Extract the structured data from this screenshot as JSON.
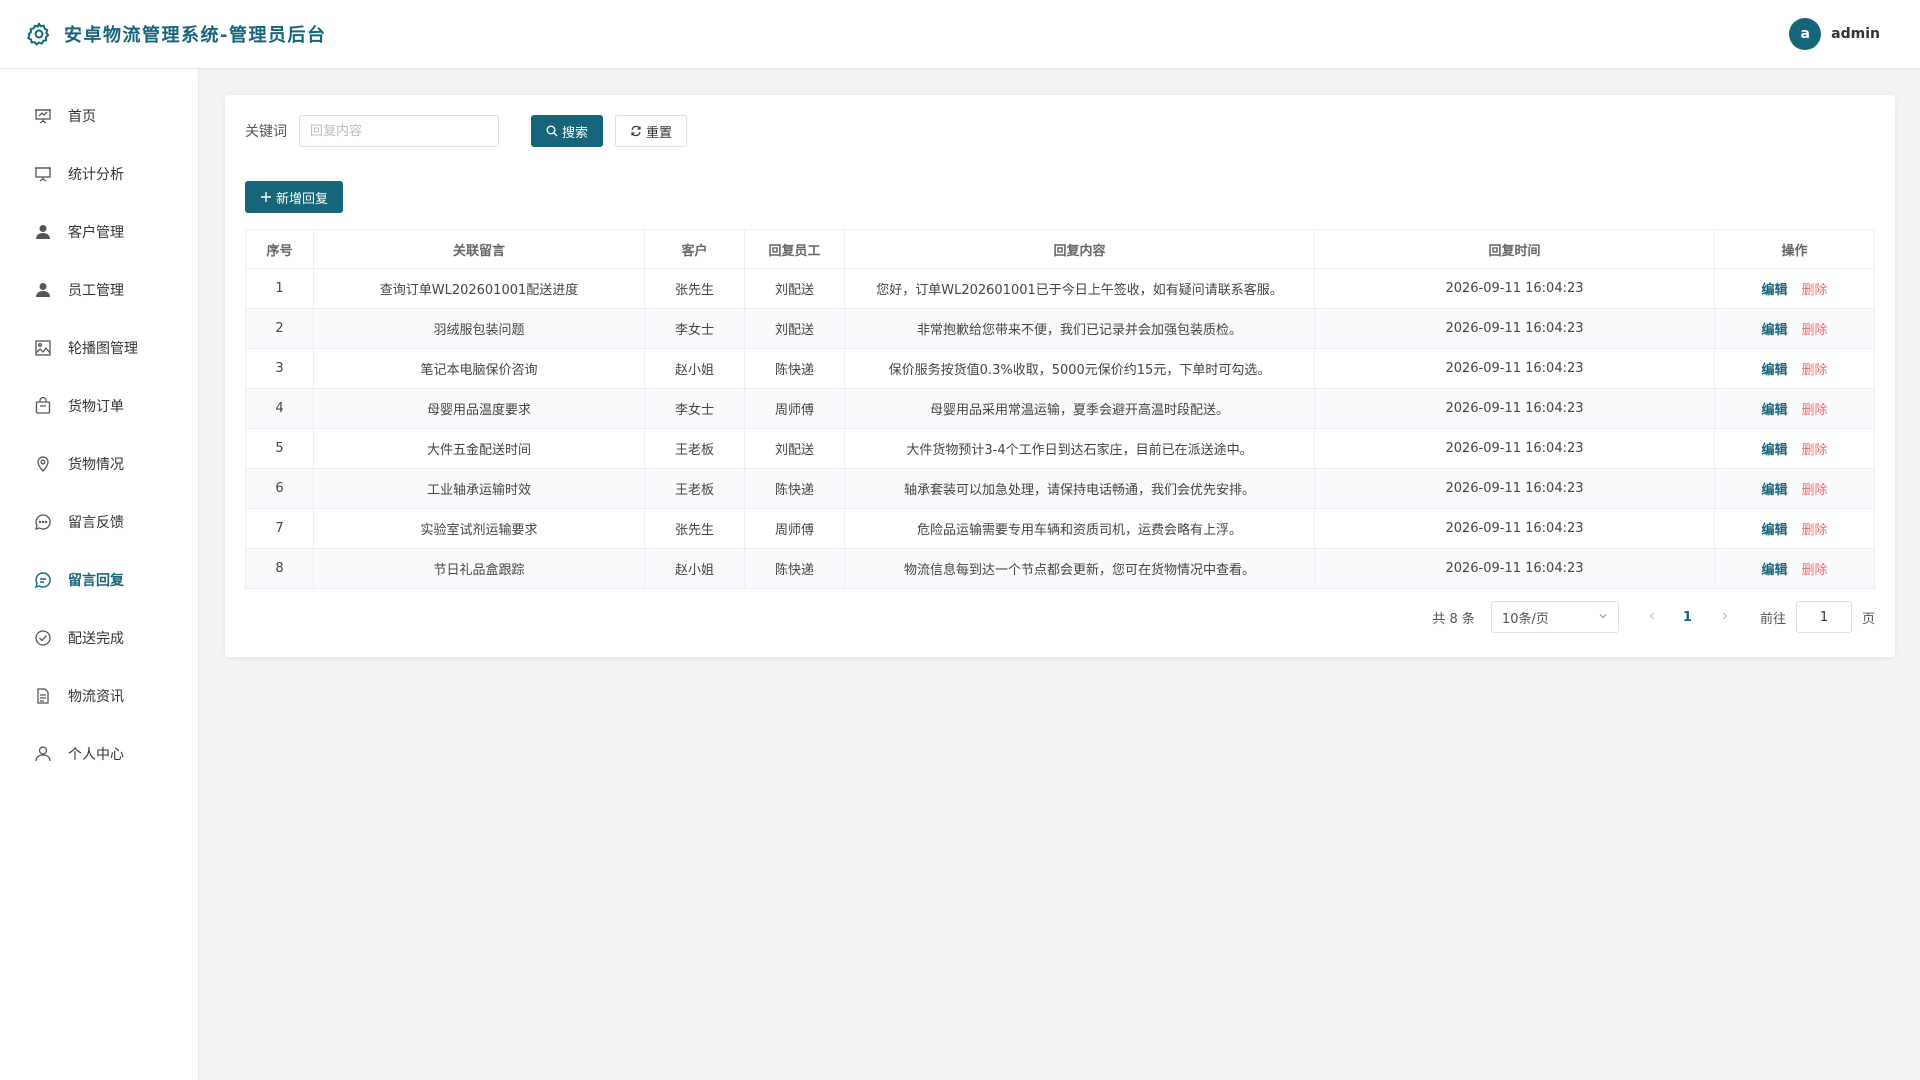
{
  "app": {
    "title": "安卓物流管理系统-管理员后台"
  },
  "user": {
    "avatar_letter": "a",
    "name": "admin"
  },
  "sidebar": {
    "items": [
      {
        "label": "首页",
        "icon": "presentation-icon"
      },
      {
        "label": "统计分析",
        "icon": "presentation-icon"
      },
      {
        "label": "客户管理",
        "icon": "user-icon"
      },
      {
        "label": "员工管理",
        "icon": "user-icon"
      },
      {
        "label": "轮播图管理",
        "icon": "picture-icon"
      },
      {
        "label": "货物订单",
        "icon": "bag-icon"
      },
      {
        "label": "货物情况",
        "icon": "location-icon"
      },
      {
        "label": "留言反馈",
        "icon": "chat-dots-icon"
      },
      {
        "label": "留言回复",
        "icon": "chat-reply-icon",
        "active": true
      },
      {
        "label": "配送完成",
        "icon": "check-circle-icon"
      },
      {
        "label": "物流资讯",
        "icon": "document-icon"
      },
      {
        "label": "个人中心",
        "icon": "user-outline-icon"
      }
    ],
    "active_color": "#17657a"
  },
  "search": {
    "label": "关键词",
    "placeholder": "回复内容",
    "value": "",
    "search_label": "搜索",
    "reset_label": "重置"
  },
  "toolbar": {
    "add_label": "新增回复"
  },
  "table": {
    "headers": [
      "序号",
      "关联留言",
      "客户",
      "回复员工",
      "回复内容",
      "回复时间",
      "操作"
    ],
    "edit_label": "编辑",
    "delete_label": "删除",
    "rows": [
      [
        "1",
        "查询订单WL202601001配送进度",
        "张先生",
        "刘配送",
        "您好，订单WL202601001已于今日上午签收，如有疑问请联系客服。",
        "2026-09-11 16:04:23"
      ],
      [
        "2",
        "羽绒服包装问题",
        "李女士",
        "刘配送",
        "非常抱歉给您带来不便，我们已记录并会加强包装质检。",
        "2026-09-11 16:04:23"
      ],
      [
        "3",
        "笔记本电脑保价咨询",
        "赵小姐",
        "陈快递",
        "保价服务按货值0.3%收取，5000元保价约15元，下单时可勾选。",
        "2026-09-11 16:04:23"
      ],
      [
        "4",
        "母婴用品温度要求",
        "李女士",
        "周师傅",
        "母婴用品采用常温运输，夏季会避开高温时段配送。",
        "2026-09-11 16:04:23"
      ],
      [
        "5",
        "大件五金配送时间",
        "王老板",
        "刘配送",
        "大件货物预计3-4个工作日到达石家庄，目前已在派送途中。",
        "2026-09-11 16:04:23"
      ],
      [
        "6",
        "工业轴承运输时效",
        "王老板",
        "陈快递",
        "轴承套装可以加急处理，请保持电话畅通，我们会优先安排。",
        "2026-09-11 16:04:23"
      ],
      [
        "7",
        "实验室试剂运输要求",
        "张先生",
        "周师傅",
        "危险品运输需要专用车辆和资质司机，运费会略有上浮。",
        "2026-09-11 16:04:23"
      ],
      [
        "8",
        "节日礼品盒跟踪",
        "赵小姐",
        "陈快递",
        "物流信息每到达一个节点都会更新，您可在货物情况中查看。",
        "2026-09-11 16:04:23"
      ]
    ]
  },
  "pagination": {
    "total_text": "共 8 条",
    "page_size": "10条/页",
    "current_page": "1",
    "goto_label": "前往",
    "goto_value": "1",
    "page_suffix": "页"
  },
  "colors": {
    "primary": "#17657a",
    "danger": "#f56c6c"
  }
}
